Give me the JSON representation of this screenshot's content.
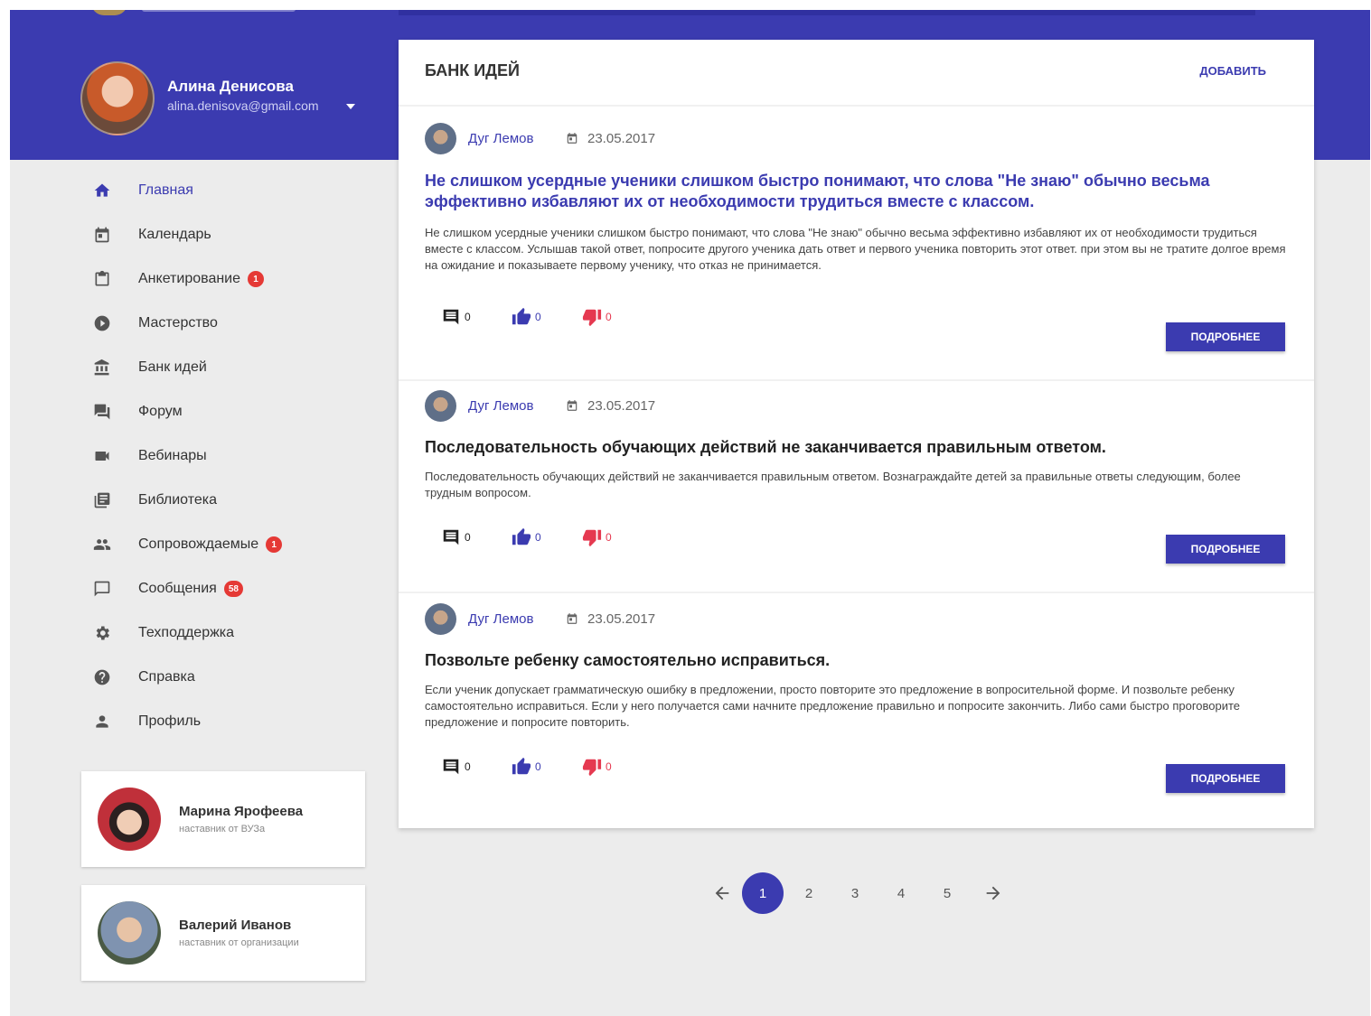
{
  "user": {
    "name": "Алина Денисова",
    "email": "alina.denisova@gmail.com"
  },
  "nav": [
    {
      "label": "Главная",
      "icon": "home-icon",
      "active": true,
      "badge": ""
    },
    {
      "label": "Календарь",
      "icon": "calendar-icon",
      "badge": ""
    },
    {
      "label": "Анкетирование",
      "icon": "clipboard-icon",
      "badge": "1"
    },
    {
      "label": "Мастерство",
      "icon": "play-circle-icon",
      "badge": ""
    },
    {
      "label": "Банк идей",
      "icon": "bank-icon",
      "badge": ""
    },
    {
      "label": "Форум",
      "icon": "forum-icon",
      "badge": ""
    },
    {
      "label": "Вебинары",
      "icon": "videocam-icon",
      "badge": ""
    },
    {
      "label": "Библиотека",
      "icon": "library-icon",
      "badge": ""
    },
    {
      "label": "Сопровождаемые",
      "icon": "people-icon",
      "badge": "1"
    },
    {
      "label": "Сообщения",
      "icon": "message-icon",
      "badge": "58"
    },
    {
      "label": "Техподдержка",
      "icon": "gear-icon",
      "badge": ""
    },
    {
      "label": "Справка",
      "icon": "help-icon",
      "badge": ""
    },
    {
      "label": "Профиль",
      "icon": "person-icon",
      "badge": ""
    }
  ],
  "mentors": [
    {
      "name": "Марина Ярофеева",
      "role": "наставник от ВУЗа"
    },
    {
      "name": "Валерий Иванов",
      "role": "наставник от организации"
    }
  ],
  "main": {
    "title": "БАНК ИДЕЙ",
    "add_label": "ДОБАВИТЬ",
    "more_label": "ПОДРОБНЕЕ",
    "ideas": [
      {
        "author": "Дуг Лемов",
        "date": "23.05.2017",
        "title": "Не слишком усердные ученики слишком быстро понимают, что слова \"Не знаю\" обычно весьма эффективно избавляют их от необходимости трудиться вместе с классом.",
        "text": "Не слишком усердные ученики слишком быстро понимают, что слова \"Не знаю\" обычно весьма эффективно избавляют их от необходимости трудиться вместе с классом. Услышав такой ответ, попросите другого ученика дать ответ и первого ученика повторить этот ответ. при этом вы не тратите долгое время на ожидание и показываете первому ученику, что отказ не принимается.",
        "comments": "0",
        "likes": "0",
        "dislikes": "0"
      },
      {
        "author": "Дуг Лемов",
        "date": "23.05.2017",
        "title": "Последовательность обучающих действий не заканчивается правильным ответом.",
        "text": "Последовательность обучающих действий не заканчивается правильным ответом. Вознаграждайте детей за правильные ответы следующим, более трудным вопросом.",
        "comments": "0",
        "likes": "0",
        "dislikes": "0"
      },
      {
        "author": "Дуг Лемов",
        "date": "23.05.2017",
        "title": "Позвольте ребенку самостоятельно исправиться.",
        "text": "Если ученик допускает грамматическую ошибку в предложении, просто повторите это предложение в вопросительной форме. И позвольте ребенку самостоятельно исправиться. Если у него получается сами начните предложение правильно и попросите закончить. Либо сами быстро проговорите предложение и попросите повторить.",
        "comments": "0",
        "likes": "0",
        "dislikes": "0"
      }
    ]
  },
  "pagination": {
    "pages": [
      "1",
      "2",
      "3",
      "4",
      "5"
    ],
    "current": "1"
  },
  "colors": {
    "primary": "#3b3bb0",
    "like": "#3b3bb0",
    "dislike": "#e53950",
    "badge": "#e53935",
    "background": "#ececec"
  }
}
